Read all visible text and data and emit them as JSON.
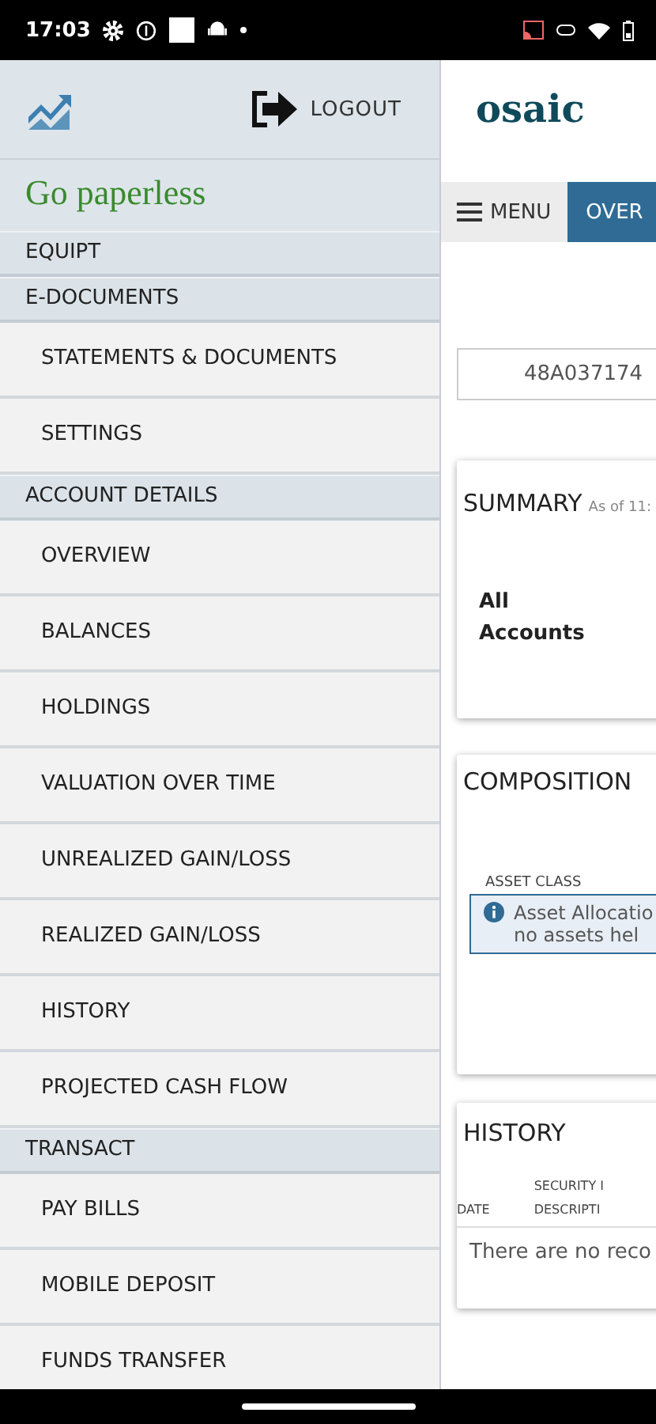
{
  "status_bar": {
    "time": "17:03"
  },
  "drawer": {
    "logout": "LOGOUT",
    "promo": "Go paperless",
    "sections": [
      {
        "title": "EQUIPT"
      },
      {
        "title": "E-DOCUMENTS",
        "items": [
          {
            "label": "STATEMENTS & DOCUMENTS"
          },
          {
            "label": "SETTINGS"
          }
        ]
      },
      {
        "title": "ACCOUNT DETAILS",
        "items": [
          {
            "label": "OVERVIEW"
          },
          {
            "label": "BALANCES"
          },
          {
            "label": "HOLDINGS"
          },
          {
            "label": "VALUATION OVER TIME"
          },
          {
            "label": "UNREALIZED GAIN/LOSS"
          },
          {
            "label": "REALIZED GAIN/LOSS"
          },
          {
            "label": "HISTORY"
          },
          {
            "label": "PROJECTED CASH FLOW"
          }
        ]
      },
      {
        "title": "TRANSACT",
        "items": [
          {
            "label": "PAY BILLS"
          },
          {
            "label": "MOBILE DEPOSIT"
          },
          {
            "label": "FUNDS TRANSFER"
          }
        ]
      }
    ]
  },
  "main": {
    "logo": "osaic",
    "tabs": [
      {
        "label": "MENU",
        "kind": "menu",
        "selected": false
      },
      {
        "label": "OVER",
        "kind": "tab",
        "selected": true
      }
    ],
    "account": "48A037174",
    "summary": {
      "title": "SUMMARY",
      "as_of": "As of 11:",
      "scope": "All Accounts"
    },
    "composition": {
      "title": "COMPOSITION",
      "column": "ASSET CLASS",
      "notice": [
        "Asset Allocatio",
        "no assets hel"
      ]
    },
    "history": {
      "title": "HISTORY",
      "columns": [
        {
          "bottom": "DATE"
        },
        {
          "top": "SECURITY I",
          "bottom": "DESCRIPTI"
        }
      ],
      "empty": "There are no reco"
    }
  }
}
